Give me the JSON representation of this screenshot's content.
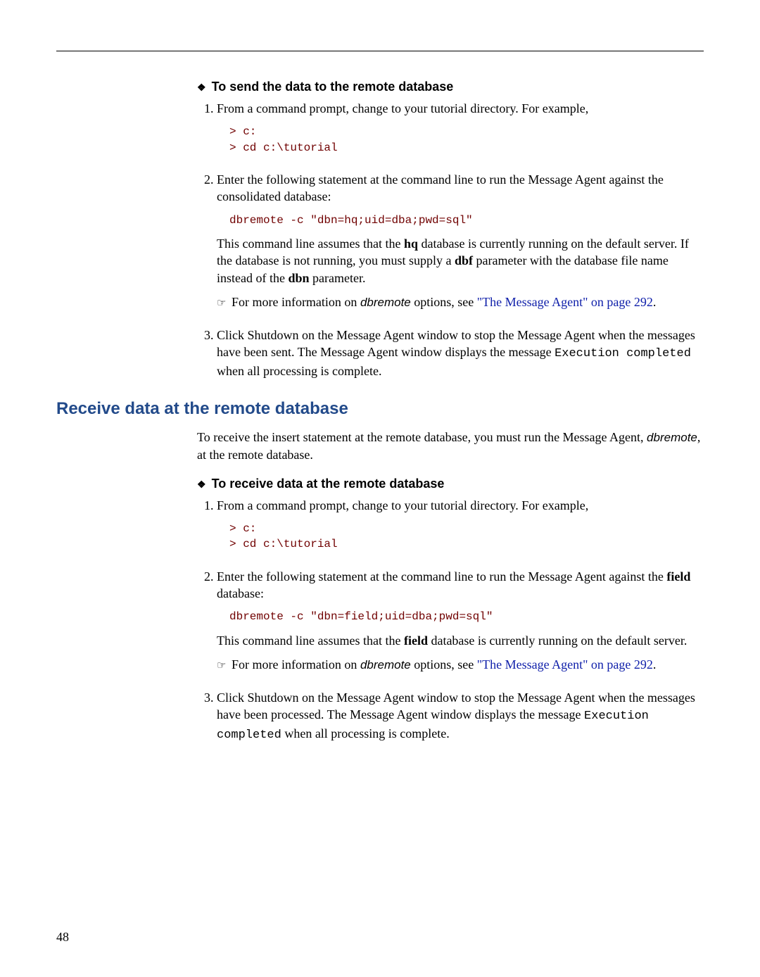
{
  "pagenum": "48",
  "s1": {
    "title": "To send the data to the remote database",
    "i1": {
      "text": "From a command prompt, change to your tutorial directory. For example,",
      "code": "> c:\n> cd c:\\tutorial"
    },
    "i2": {
      "text1": "Enter the following statement at the command line to run the Message Agent against the consolidated database:",
      "code": "dbremote -c \"dbn=hq;uid=dba;pwd=sql\"",
      "p1a": "This command line assumes that the ",
      "p1b": "hq",
      "p1c": " database is currently running on the default server. If the database is not running, you must supply a ",
      "p1d": "dbf",
      "p1e": " parameter with the database file name instead of the ",
      "p1f": "dbn",
      "p1g": " parameter.",
      "p2a": "For more information on ",
      "p2b": "dbremote",
      "p2c": " options, see ",
      "p2link": "\"The Message Agent\" on page 292",
      "p2d": "."
    },
    "i3": {
      "a": "Click Shutdown on the Message Agent window to stop the Message Agent when the messages have been sent. The Message Agent window displays the message ",
      "b": "Execution completed",
      "c": " when all processing is complete."
    }
  },
  "h2": "Receive data at the remote database",
  "intro": {
    "a": "To receive the insert statement at the remote database, you must run the Message Agent, ",
    "b": "dbremote",
    "c": ", at the remote database."
  },
  "s2": {
    "title": "To receive data at the remote database",
    "i1": {
      "text": "From a command prompt, change to your tutorial directory. For example,",
      "code": "> c:\n> cd c:\\tutorial"
    },
    "i2": {
      "text1a": "Enter the following statement at the command line to run the Message Agent against the ",
      "text1b": "field",
      "text1c": " database:",
      "code": "dbremote -c \"dbn=field;uid=dba;pwd=sql\"",
      "p1a": "This command line assumes that the ",
      "p1b": "field",
      "p1c": " database is currently running on the default server.",
      "p2a": "For more information on ",
      "p2b": "dbremote",
      "p2c": " options, see ",
      "p2link": "\"The Message Agent\" on page 292",
      "p2d": "."
    },
    "i3": {
      "a": "Click Shutdown on the Message Agent window to stop the Message Agent when the messages have been processed. The Message Agent window displays the message ",
      "b": "Execution completed",
      "c": " when all processing is complete."
    }
  }
}
